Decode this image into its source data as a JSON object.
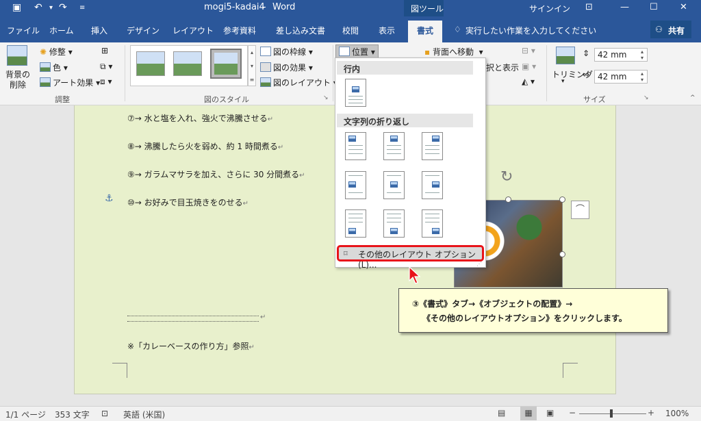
{
  "titlebar": {
    "filename": "mogi5-kadai4",
    "separator": "-",
    "app": "Word",
    "context_tab": "図ツール",
    "signin": "サインイン"
  },
  "tabs": [
    "ファイル",
    "ホーム",
    "挿入",
    "デザイン",
    "レイアウト",
    "参考資料",
    "差し込み文書",
    "校閲",
    "表示",
    "書式"
  ],
  "tellme": "実行したい作業を入力してください",
  "share": "共有",
  "ribbon": {
    "remove_bg": [
      "背景の",
      "削除"
    ],
    "corrections": "修整",
    "color": "色",
    "artistic": "アート効果",
    "adjust_label": "調整",
    "picture_border": "図の枠線",
    "picture_effects": "図の効果",
    "picture_layout": "図のレイアウト",
    "styles_label": "図のスタイル",
    "position": "位置",
    "send_backward": "背面へ移動",
    "selection_pane": "択と表示",
    "crop": "トリミング",
    "height": "42 mm",
    "width": "42 mm",
    "size_label": "サイズ"
  },
  "dropdown": {
    "inline_header": "行内",
    "wrap_header": "文字列の折り返し",
    "more_options": "その他のレイアウト オプション(L)..."
  },
  "document": {
    "lines": [
      "⑦→ 水と塩を入れ、強火で沸騰させる",
      "⑧→ 沸騰したら火を弱め、約 1 時間煮る",
      "⑨→ ガラムマサラを加え、さらに 30 分間煮る",
      "⑩→ お好みで目玉焼きをのせる"
    ],
    "note": "※「カレーベースの作り方」参照"
  },
  "callout": {
    "line1": "③《書式》タブ→《オブジェクトの配置》→",
    "line2": "《その他のレイアウトオプション》をクリックします。"
  },
  "status": {
    "page": "1/1 ページ",
    "words": "353 文字",
    "language": "英語 (米国)",
    "zoom": "100%"
  },
  "colors": {
    "titlebar": "#2b579a",
    "page": "#e8f0cc",
    "callout": "#ffffd9",
    "highlight": "#e8131a"
  }
}
